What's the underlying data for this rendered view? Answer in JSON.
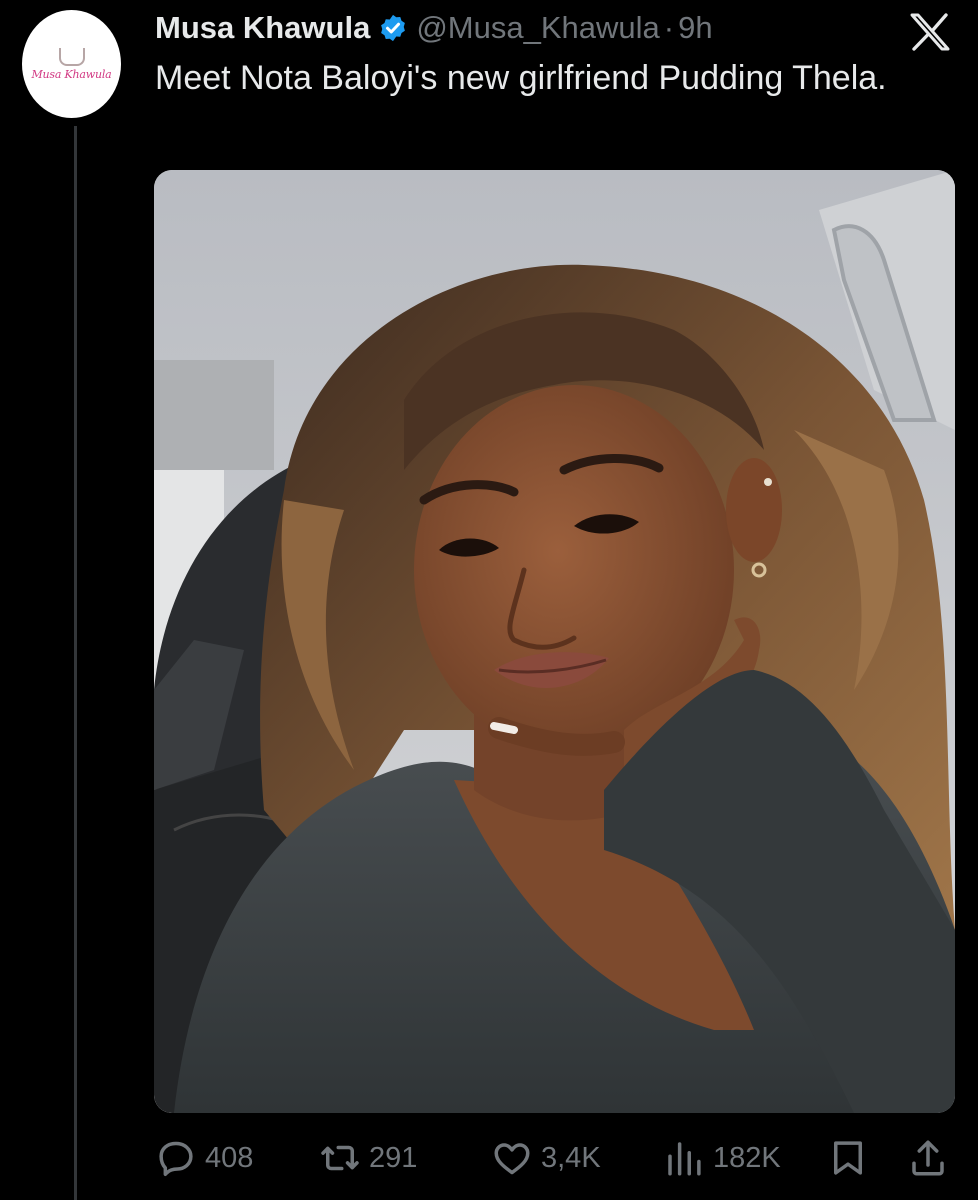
{
  "author": {
    "name": "Musa Khawula",
    "handle": "@Musa_Khawula",
    "separator": "·",
    "time": "9h",
    "avatar_text": "Musa Khawula"
  },
  "tweet": {
    "text": "Meet Nota Baloyi's new girlfriend Pudding Thela."
  },
  "stats": {
    "replies": "408",
    "retweets": "291",
    "likes": "3,4K",
    "views": "182K"
  },
  "icons": {
    "verified": "verified-badge-icon",
    "logo": "x-logo-icon",
    "reply": "reply-icon",
    "retweet": "retweet-icon",
    "like": "heart-icon",
    "views": "views-chart-icon",
    "bookmark": "bookmark-icon",
    "share": "share-icon"
  },
  "colors": {
    "background": "#000000",
    "text": "#e7e9ea",
    "secondary_text": "#71767b",
    "verified": "#1d9bf0",
    "avatar_brand": "#d23a84"
  }
}
